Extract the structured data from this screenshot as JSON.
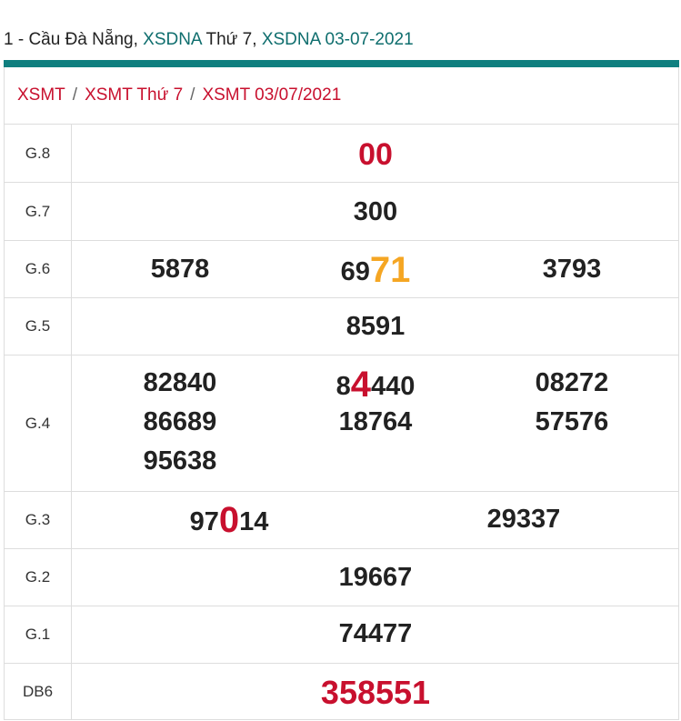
{
  "header": {
    "prefix": "1 - Cầu Đà Nẵng,",
    "link1": "XSDNA",
    "middle": "Thứ 7,",
    "link2": "XSDNA 03-07-2021",
    "accent": "#0f7f7f"
  },
  "breadcrumb": {
    "items": [
      "XSMT",
      "XSMT Thứ 7",
      "XSMT 03/07/2021"
    ],
    "separator": "/"
  },
  "prizes": {
    "g8": {
      "label": "G.8",
      "value": "00"
    },
    "g7": {
      "label": "G.7",
      "value": "300"
    },
    "g6": {
      "label": "G.6",
      "values": [
        "5878",
        "6971",
        "3793"
      ],
      "v2_pre": "69",
      "v2_hl": "71"
    },
    "g5": {
      "label": "G.5",
      "value": "8591"
    },
    "g4": {
      "label": "G.4",
      "values": [
        "82840",
        "84440",
        "08272",
        "86689",
        "18764",
        "57576",
        "95638"
      ],
      "v2_pre": "8",
      "v2_hl": "4",
      "v2_post": "440"
    },
    "g3": {
      "label": "G.3",
      "values": [
        "97014",
        "29337"
      ],
      "v1_pre": "97",
      "v1_hl": "0",
      "v1_post": "14"
    },
    "g2": {
      "label": "G.2",
      "value": "19667"
    },
    "g1": {
      "label": "G.1",
      "value": "74477"
    },
    "db": {
      "label": "DB6",
      "value": "358551"
    }
  },
  "colors": {
    "red": "#c8102e",
    "orange": "#f5a623",
    "teal": "#0f7f7f"
  }
}
